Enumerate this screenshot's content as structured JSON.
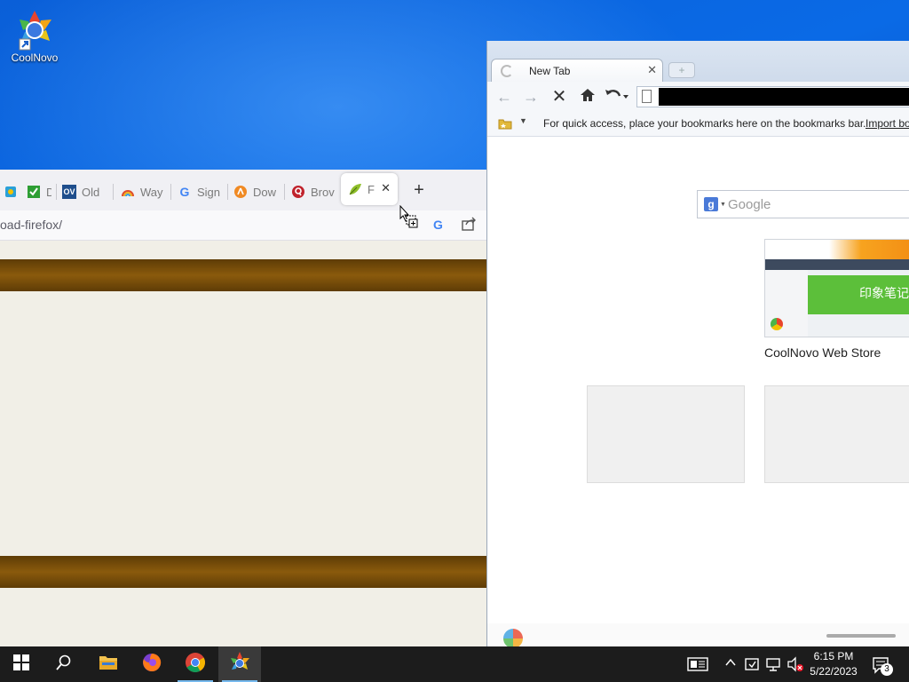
{
  "desktop": {
    "icons": [
      {
        "label": "CoolNovo",
        "icon": "coolnovo-icon"
      }
    ]
  },
  "firefox": {
    "tabs": [
      {
        "label": "",
        "icon": "puzzle-icon",
        "color": "#2aa0d8"
      },
      {
        "label": "D",
        "icon": "checkmark-icon",
        "color": "#2e9e34"
      },
      {
        "label": "Old",
        "icon": "ov-icon",
        "color": "#1f4e8c"
      },
      {
        "label": "Way",
        "icon": "rainbow-icon",
        "color": "#e04d2a"
      },
      {
        "label": "Sign",
        "icon": "google-g-icon",
        "color": "#4285f4"
      },
      {
        "label": "Dow",
        "icon": "download-site-icon",
        "color": "#f08a24"
      },
      {
        "label": "Brov",
        "icon": "quora-icon",
        "color": "#c0222c"
      },
      {
        "label": "F",
        "icon": "leaf-icon",
        "color": "#8fbf2a"
      }
    ],
    "active_tab_close": "✕",
    "new_tab": "+",
    "url": "oad-firefox/"
  },
  "coolnovo": {
    "tab_title": "New Tab",
    "tab_close": "✕",
    "bookmarks_message": "For quick access, place your bookmarks here on the bookmarks bar.",
    "import_link": "Import bo",
    "search_placeholder": "Google",
    "search_engine_letter": "g",
    "thumbnail_label": "CoolNovo Web Store",
    "thumbnail_chinese": "印象笔记"
  },
  "taskbar": {
    "time": "6:15 PM",
    "date": "5/22/2023",
    "notifications": "3"
  },
  "colors": {
    "taskbar": "#1c1c1c",
    "accent": "#76b9ed",
    "band": "#7a4e0a"
  }
}
